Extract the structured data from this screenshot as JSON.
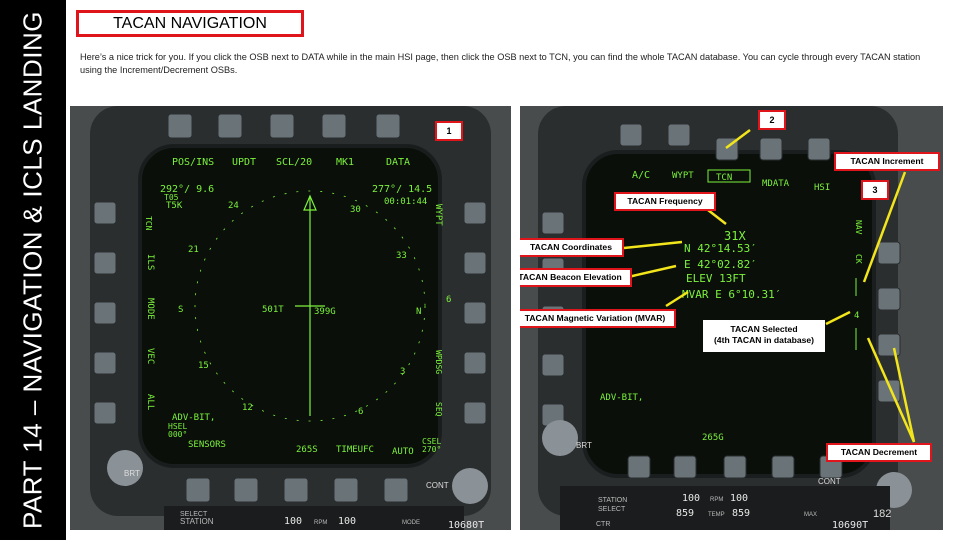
{
  "sidebar": {
    "text": "PART 14 – NAVIGATION & ICLS LANDING"
  },
  "title": "TACAN NAVIGATION",
  "intro": "Here’s a nice trick for you. If you click the OSB next to DATA while in the main HSI page, then click the OSB next to TCN, you can find the whole TACAN database. You can cycle through every TACAN station using the Increment/Decrement OSBs.",
  "left_mfd": {
    "top_labels": [
      "POS/INS",
      "UPDT",
      "SCL/20",
      "MK1",
      "DATA"
    ],
    "left_labels": [
      "TCN",
      "ILS",
      "MODE",
      "VEC",
      "ALL"
    ],
    "right_labels": [
      "WYPT",
      "WPDSG",
      "SEQ"
    ],
    "bottom_labels": [
      "SENSORS",
      "265S",
      "TIMEUFC",
      "AUTO"
    ],
    "heading_readout": "292°/ 9.6",
    "heading_sub": "T05",
    "tacan_code": "T5K",
    "range_readout": "277°/ 14.5",
    "time_readout": "00:01:44",
    "compass": [
      "24",
      "30",
      "21",
      "33",
      "S",
      "N",
      "15",
      "3",
      "12",
      "6",
      "6"
    ],
    "center_left": "501T",
    "center_right": "399G",
    "status": "ADV-BIT,",
    "hsel": "HSEL",
    "hsel_value": "000°",
    "csel": "CSEL",
    "csel_value": "270°",
    "brt": "BRT",
    "cont": "CONT",
    "ufc_left": "100",
    "ufc_rpm": "RPM",
    "ufc_right": "100",
    "ufc_select": "SELECT",
    "ufc_station": "STATION",
    "ufc_mode": "MODE",
    "ufc_fuel": "10680T"
  },
  "right_mfd": {
    "top_labels": [
      "A/C",
      "WYPT",
      "TCN",
      "MDATA",
      "HSI"
    ],
    "right_labels": [
      "NAV",
      "CK"
    ],
    "frequency": "31X",
    "coord_n": "N 42°14.53′",
    "coord_e": "E 42°02.82′",
    "elev": "ELEV 13FT",
    "mvar": "MVAR E  6°10.31′",
    "selected_index": "4",
    "status": "ADV-BIT,",
    "bottom_value": "265G",
    "brt": "BRT",
    "cont": "CONT",
    "ufc_left": "100",
    "ufc_rpm": "RPM",
    "ufc_right": "100",
    "ufc_row2_left": "859",
    "ufc_temp": "TEMP",
    "ufc_row2_right": "859",
    "ufc_select": "SELECT",
    "ufc_station": "STATION",
    "ufc_ctr": "CTR",
    "ufc_max": "MAX",
    "ufc_fuel": "10690T"
  },
  "annotations": {
    "step1": "1",
    "step2": "2",
    "step3": "3",
    "tacan_frequency": "TACAN Frequency",
    "tacan_coordinates": "TACAN Coordinates",
    "tacan_beacon_elevation": "TACAN Beacon Elevation",
    "tacan_mvar": "TACAN Magnetic Variation (MVAR)",
    "tacan_increment": "TACAN Increment",
    "tacan_selected_line1": "TACAN Selected",
    "tacan_selected_line2": "(4th TACAN in database)",
    "tacan_decrement": "TACAN Decrement"
  },
  "page_number": "182",
  "colors": {
    "accent_red": "#e0141b",
    "mfd_green": "#7cf23b",
    "annotation_yellow": "#f2e51b"
  }
}
